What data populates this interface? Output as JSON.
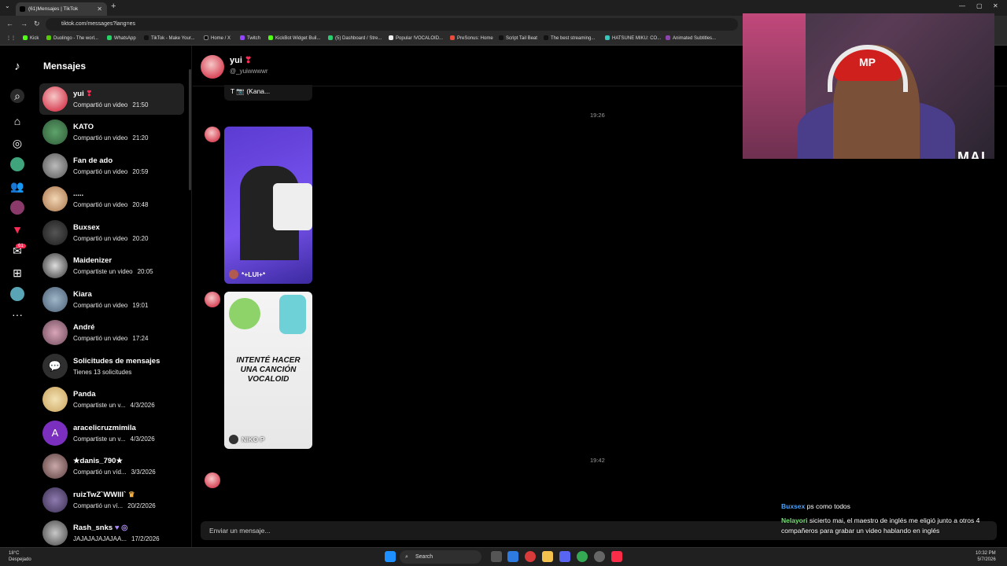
{
  "browser": {
    "tab_title": "(61)Mensajes | TikTok",
    "url": "tiktok.com/messages?lang=es",
    "bookmarks": [
      "Kick",
      "Duolingo - The worl...",
      "WhatsApp",
      "TikTok - Make Your...",
      "Home / X",
      "Twitch",
      "KickBot Widget Buil...",
      "(5) Dashboard / Stre...",
      "Popular !VOCALOID...",
      "PreSonus: Home",
      "Script Tail Beat",
      "The best streaming...",
      "HATSUNE MIKU: CO...",
      "Animated Subtitles..."
    ]
  },
  "rail": {
    "notif_badge": "61"
  },
  "sidebar": {
    "title": "Mensajes",
    "conversations": [
      {
        "name": "yui",
        "preview": "Compartió un video",
        "time": "21:50"
      },
      {
        "name": "KATO",
        "preview": "Compartió un video",
        "time": "21:20"
      },
      {
        "name": "Fan de ado",
        "preview": "Compartió un video",
        "time": "20:59"
      },
      {
        "name": ".....",
        "preview": "Compartió un video",
        "time": "20:48"
      },
      {
        "name": "Buxsex",
        "preview": "Compartió un video",
        "time": "20:20"
      },
      {
        "name": "Maidenizer",
        "preview": "Compartiste un video",
        "time": "20:05"
      },
      {
        "name": "Kiara",
        "preview": "Compartió un video",
        "time": "19:01"
      },
      {
        "name": "André",
        "preview": "Compartió un video",
        "time": "17:24"
      },
      {
        "name": "Solicitudes de mensajes",
        "preview": "Tienes 13 solicitudes",
        "time": ""
      },
      {
        "name": "Panda",
        "preview": "Compartiste un v...",
        "time": "4/3/2026"
      },
      {
        "name": "aracelicruzmimila",
        "preview": "Compartiste un v...",
        "time": "4/3/2026"
      },
      {
        "name": "★danis_790★",
        "preview": "Compartió un víd...",
        "time": "3/3/2026"
      },
      {
        "name": "ruizTwZ`WWIII`",
        "preview": "Compartió un ví...",
        "time": "20/2/2026"
      },
      {
        "name": "Rash_snks",
        "preview": "JAJAJAJAJAJAA...",
        "time": "17/2/2026"
      }
    ]
  },
  "chat": {
    "name": "yui",
    "handle": "@_yuiwwwwr",
    "top_card_author": "T 📷 (Kana...",
    "stamp1": "19:26",
    "card1_author": "*+LUI+*",
    "card2_text": "INTENTÉ HACER UNA CANCIÓN VOCALOID",
    "card2_author": "NIKO P",
    "stamp2": "19:42",
    "input_placeholder": "Enviar un mensaje..."
  },
  "stream_overlay": {
    "cam_label": "MAI",
    "chat": [
      {
        "user": "Buxsex",
        "text": "ps como todos"
      },
      {
        "user": "Nelayori",
        "text": "sicierto mai, el maestro de inglés me eligió junto a otros 4 compañeros para grabar un video hablando en inglés"
      }
    ]
  },
  "taskbar": {
    "weather_temp": "18°C",
    "weather_desc": "Despejado",
    "search_label": "Search",
    "time": "10:32 PM",
    "date": "5/7/2026"
  },
  "colors": {
    "accent": "#fe2c55",
    "bg": "#000000",
    "active_row": "#222222"
  }
}
